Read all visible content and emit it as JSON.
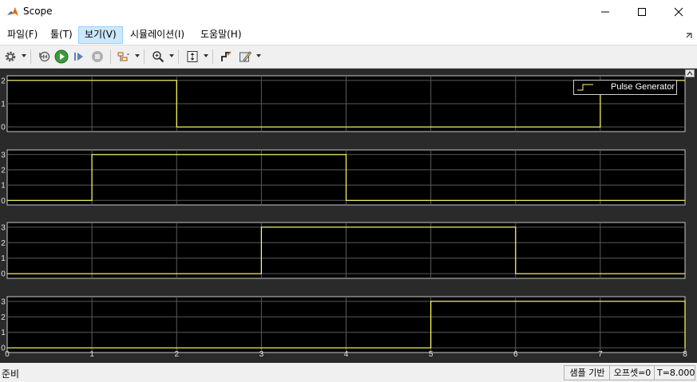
{
  "window": {
    "title": "Scope"
  },
  "menu": {
    "items": [
      "파일(F)",
      "툴(T)",
      "보기(V)",
      "시뮬레이션(I)",
      "도움말(H)"
    ],
    "active_index": 2
  },
  "toolbar": {
    "icons": [
      "gear-icon",
      "rewind-icon",
      "run-icon",
      "step-forward-icon",
      "stop-icon",
      "cursor-measure-icon",
      "zoom-in-icon",
      "scale-axes-icon",
      "highlight-block-icon",
      "style-icon"
    ]
  },
  "scope": {
    "legend": "Pulse Generator",
    "trace_color": "#ffff66",
    "background_color": "#000000",
    "x_ticks": [
      "0",
      "1",
      "2",
      "3",
      "4",
      "5",
      "6",
      "7",
      "8"
    ]
  },
  "chart_data": [
    {
      "type": "line",
      "x": [
        0,
        2,
        2,
        7,
        7,
        8
      ],
      "y": [
        2,
        2,
        0,
        0,
        2,
        2
      ],
      "ylim": [
        -0.2,
        2.2
      ],
      "yticks": [
        "0",
        "1",
        "2"
      ],
      "legend": "Pulse Generator",
      "xlim": [
        0,
        8
      ]
    },
    {
      "type": "line",
      "x": [
        0,
        1,
        1,
        4,
        4,
        8
      ],
      "y": [
        0,
        0,
        3,
        3,
        0,
        0
      ],
      "ylim": [
        -0.3,
        3.3
      ],
      "yticks": [
        "0",
        "1",
        "2",
        "3"
      ],
      "xlim": [
        0,
        8
      ]
    },
    {
      "type": "line",
      "x": [
        0,
        3,
        3,
        6,
        6,
        8
      ],
      "y": [
        0,
        0,
        3,
        3,
        0,
        0
      ],
      "ylim": [
        -0.3,
        3.3
      ],
      "yticks": [
        "0",
        "1",
        "2",
        "3"
      ],
      "xlim": [
        0,
        8
      ]
    },
    {
      "type": "line",
      "x": [
        0,
        5,
        5,
        8,
        8
      ],
      "y": [
        0,
        0,
        3,
        3,
        0
      ],
      "ylim": [
        -0.3,
        3.3
      ],
      "yticks": [
        "0",
        "1",
        "2",
        "3"
      ],
      "xlim": [
        0,
        8
      ]
    }
  ],
  "status": {
    "left": "준비",
    "sample_based": "샘플 기반",
    "offset": "오프셋=0",
    "time": "T=8.000"
  }
}
